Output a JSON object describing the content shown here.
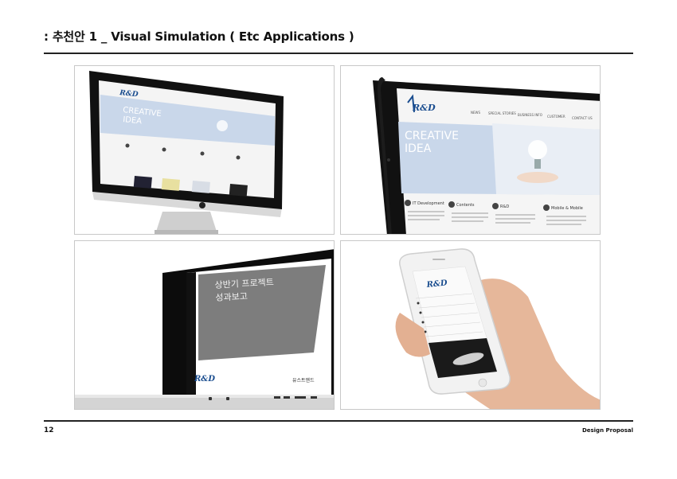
{
  "page": {
    "title": ": 추천안 1 _ Visual Simulation ( Etc Applications )",
    "page_number": "12",
    "footer_label": "Design Proposal"
  },
  "site": {
    "logo_small": "R&D",
    "hero_line1": "CREATIVE",
    "hero_line2": "IDEA",
    "nav": [
      "NEWS",
      "SPECIAL STORIES",
      "BUSINESS INFO",
      "CUSTOMER",
      "CONTACT US"
    ],
    "services": [
      "IT Development",
      "Contents",
      "R&D",
      "Mobile & Mobile"
    ]
  },
  "laptop_slide": {
    "line1": "상반기 프로젝트",
    "line2": "성과보고",
    "logo": "R&D",
    "company": "유스트앤드"
  },
  "phone": {
    "logo": "R&D"
  }
}
